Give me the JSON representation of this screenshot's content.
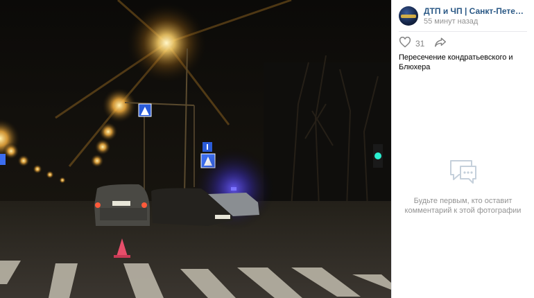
{
  "post": {
    "author_name": "ДТП и ЧП | Санкт-Петербург | Питер",
    "time": "55 минут назад",
    "like_count": "31",
    "caption": "Пересечение кондратьевского и Блюхера"
  },
  "comments": {
    "empty_line1": "Будьте первым, кто оставит",
    "empty_line2": "комментарий к этой фотографии"
  },
  "photo": {
    "scene": "night-road-accident",
    "plate_front_car": "Т 053 НР"
  },
  "icons": {
    "like": "heart-icon",
    "share": "share-arrow-icon",
    "empty_comments": "comment-bubble-icon"
  },
  "colors": {
    "author_link": "#2a5885",
    "muted": "#939393",
    "divider": "#e7e8ec"
  }
}
